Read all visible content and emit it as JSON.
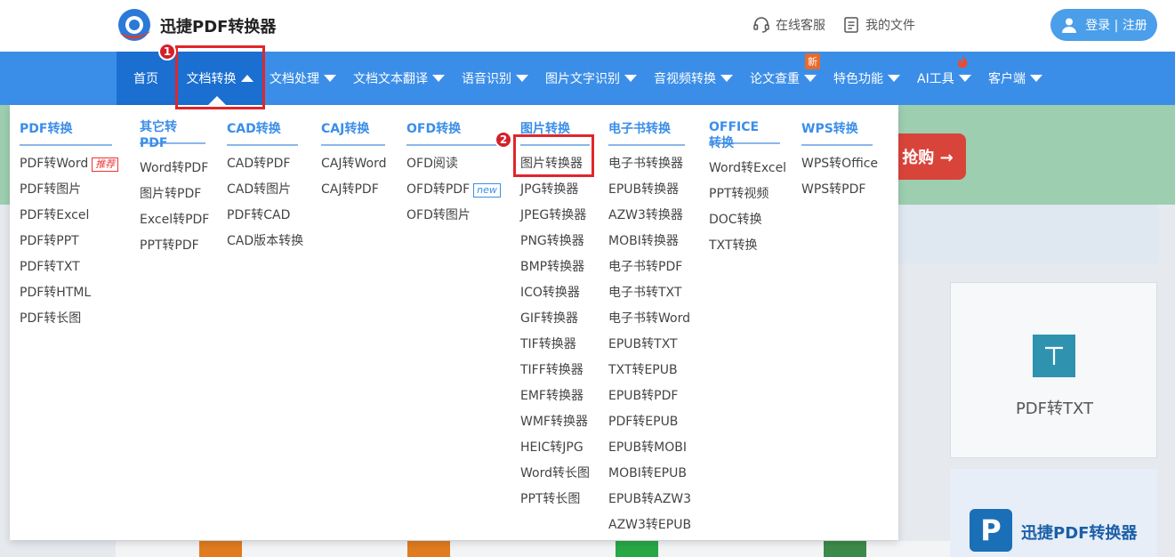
{
  "header": {
    "brand": "迅捷PDF转换器",
    "service": "在线客服",
    "my_files": "我的文件",
    "login": "登录",
    "separator": "|",
    "register": "注册"
  },
  "nav": {
    "items": [
      {
        "label": "首页",
        "caret": false
      },
      {
        "label": "文档转换",
        "caret": "up"
      },
      {
        "label": "文档处理",
        "caret": "down"
      },
      {
        "label": "文档文本翻译",
        "caret": "down"
      },
      {
        "label": "语音识别",
        "caret": "down"
      },
      {
        "label": "图片文字识别",
        "caret": "down"
      },
      {
        "label": "音视频转换",
        "caret": "down"
      },
      {
        "label": "论文查重",
        "caret": "down"
      },
      {
        "label": "特色功能",
        "caret": "down"
      },
      {
        "label": "AI工具",
        "caret": "down"
      },
      {
        "label": "客户端",
        "caret": "down"
      }
    ],
    "new_badge": "新"
  },
  "dropdown": {
    "columns": [
      {
        "head": "PDF转换",
        "items": [
          "PDF转Word",
          "PDF转图片",
          "PDF转Excel",
          "PDF转PPT",
          "PDF转TXT",
          "PDF转HTML",
          "PDF转长图"
        ]
      },
      {
        "head": "其它转PDF",
        "items": [
          "Word转PDF",
          "图片转PDF",
          "Excel转PDF",
          "PPT转PDF"
        ]
      },
      {
        "head": "CAD转换",
        "items": [
          "CAD转PDF",
          "CAD转图片",
          "PDF转CAD",
          "CAD版本转换"
        ]
      },
      {
        "head": "CAJ转换",
        "items": [
          "CAJ转Word",
          "CAJ转PDF"
        ]
      },
      {
        "head": "OFD转换",
        "items": [
          "OFD阅读",
          "OFD转PDF",
          "OFD转图片"
        ]
      },
      {
        "head": "图片转换",
        "items": [
          "图片转换器",
          "JPG转换器",
          "JPEG转换器",
          "PNG转换器",
          "BMP转换器",
          "ICO转换器",
          "GIF转换器",
          "TIF转换器",
          "TIFF转换器",
          "EMF转换器",
          "WMF转换器",
          "HEIC转JPG",
          "Word转长图",
          "PPT转长图"
        ]
      },
      {
        "head": "电子书转换",
        "items": [
          "电子书转换器",
          "EPUB转换器",
          "AZW3转换器",
          "MOBI转换器",
          "电子书转PDF",
          "电子书转TXT",
          "电子书转Word",
          "EPUB转TXT",
          "TXT转EPUB",
          "EPUB转PDF",
          "PDF转EPUB",
          "EPUB转MOBI",
          "MOBI转EPUB",
          "EPUB转AZW3",
          "AZW3转EPUB"
        ]
      },
      {
        "head": "OFFICE转换",
        "items": [
          "Word转Excel",
          "PPT转视频",
          "DOC转换",
          "TXT转换"
        ]
      },
      {
        "head": "WPS转换",
        "items": [
          "WPS转Office",
          "WPS转PDF"
        ]
      }
    ],
    "tag_hot": "推荐",
    "tag_new": "new"
  },
  "background": {
    "buy_text": "抢购 →",
    "card_label": "PDF转TXT",
    "card2_brand": "迅捷PDF转换器"
  },
  "annotations": {
    "step1": "1",
    "step2": "2"
  },
  "colors": {
    "nav_bg": "#3b8ee8",
    "nav_active": "#1a6fd1",
    "highlight": "#e0262b"
  }
}
